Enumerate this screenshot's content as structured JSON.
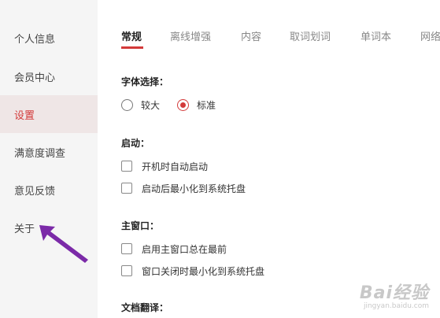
{
  "sidebar": {
    "items": [
      {
        "label": "个人信息"
      },
      {
        "label": "会员中心"
      },
      {
        "label": "设置",
        "active": true
      },
      {
        "label": "满意度调查"
      },
      {
        "label": "意见反馈"
      },
      {
        "label": "关于"
      }
    ]
  },
  "tabs": [
    {
      "label": "常规",
      "active": true
    },
    {
      "label": "离线增强"
    },
    {
      "label": "内容"
    },
    {
      "label": "取词划词"
    },
    {
      "label": "单词本"
    },
    {
      "label": "网络"
    }
  ],
  "sections": {
    "font": {
      "title": "字体选择：",
      "options": [
        {
          "label": "较大",
          "checked": false
        },
        {
          "label": "标准",
          "checked": true
        }
      ]
    },
    "startup": {
      "title": "启动：",
      "options": [
        {
          "label": "开机时自动启动",
          "checked": false
        },
        {
          "label": "启动后最小化到系统托盘",
          "checked": false
        }
      ]
    },
    "main_window": {
      "title": "主窗口：",
      "options": [
        {
          "label": "启用主窗口总在最前",
          "checked": false
        },
        {
          "label": "窗口关闭时最小化到系统托盘",
          "checked": false
        }
      ]
    },
    "doc_translate": {
      "title": "文档翻译："
    }
  },
  "colors": {
    "accent": "#d33a3a",
    "sidebar_bg": "#f5f5f5",
    "sidebar_active_bg": "#efe6e6",
    "annotation_arrow": "#7b2aa8"
  },
  "watermark": {
    "logo": "Bai经验",
    "url": "jingyan.baidu.com"
  }
}
